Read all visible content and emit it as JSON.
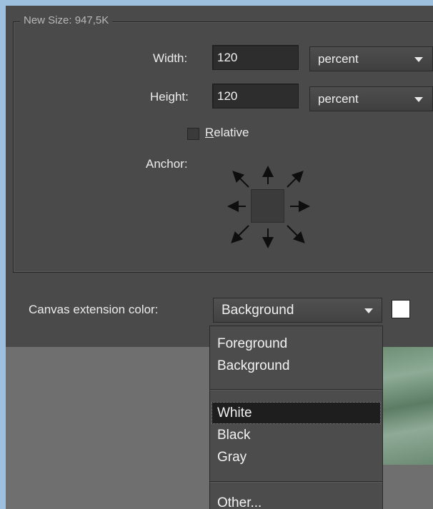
{
  "new_size": {
    "legend": "New Size: 947,5K"
  },
  "width": {
    "label": "Width:",
    "value": "120",
    "unit": "percent"
  },
  "height": {
    "label": "Height:",
    "value": "120",
    "unit": "percent"
  },
  "relative": {
    "accel": "R",
    "rest": "elative",
    "checked": false
  },
  "anchor": {
    "label": "Anchor:"
  },
  "canvas_color": {
    "label": "Canvas extension color:",
    "selected": "Background",
    "swatch_color": "#ffffff"
  },
  "menu": {
    "items": [
      {
        "label": "Foreground"
      },
      {
        "label": "Background"
      },
      {
        "label": "White",
        "highlighted": true
      },
      {
        "label": "Black"
      },
      {
        "label": "Gray"
      },
      {
        "label": "Other..."
      }
    ]
  },
  "colors": {
    "panel": "#4a4a4a",
    "field": "#2d2d2d",
    "highlight": "#1e1e1e",
    "lower_area": "#6f6f6f"
  }
}
